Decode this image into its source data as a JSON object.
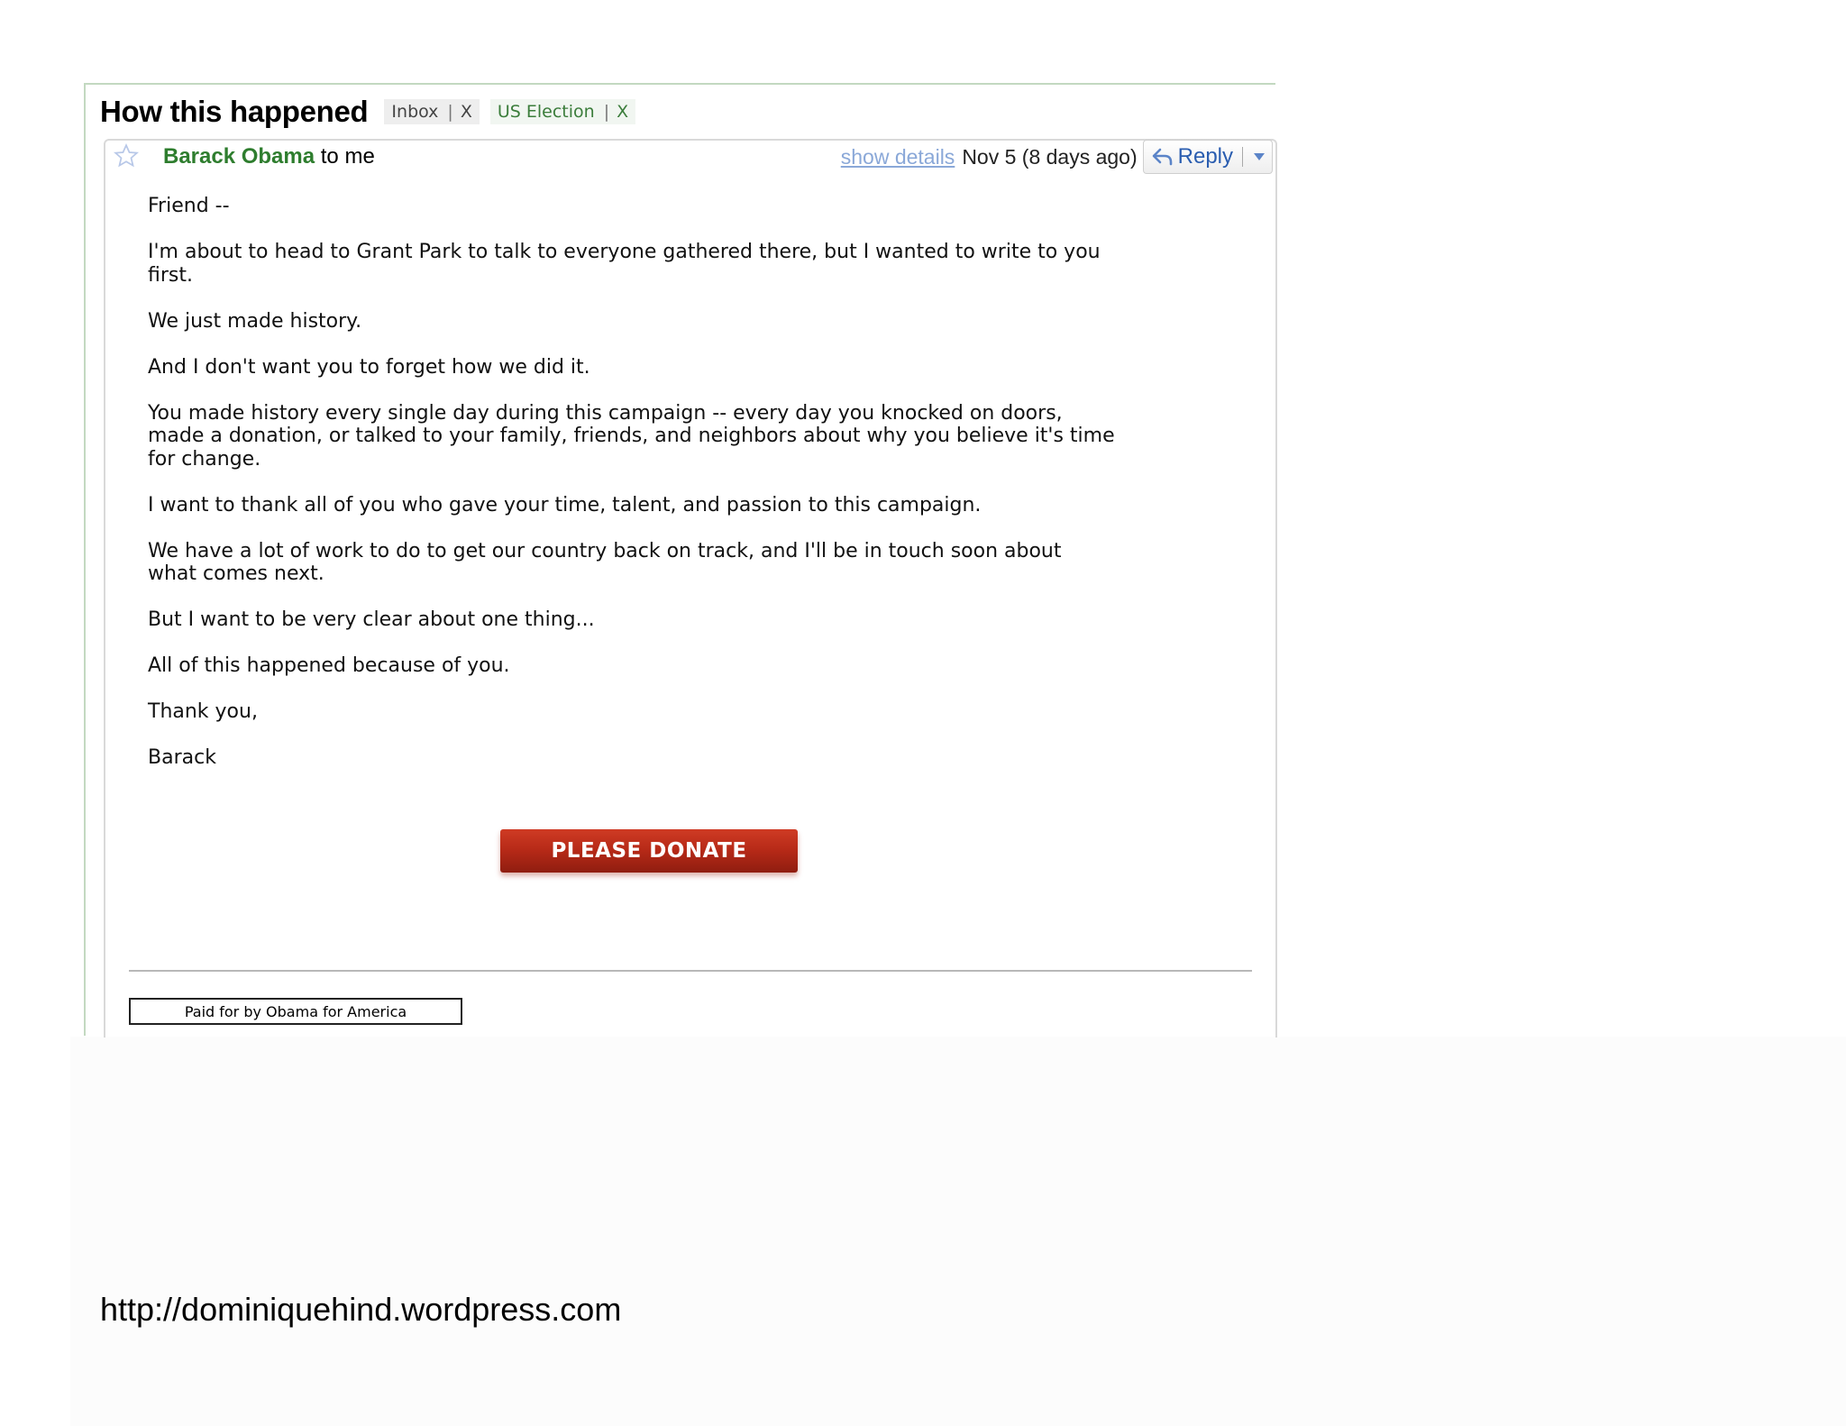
{
  "email": {
    "subject": "How this happened",
    "labels": [
      {
        "name": "Inbox",
        "remove": "X"
      },
      {
        "name": "US Election",
        "remove": "X"
      }
    ],
    "sender_name": "Barack Obama",
    "recipient": "to me",
    "show_details": "show details",
    "date": "Nov 5 (8 days ago)",
    "reply_label": "Reply",
    "body": [
      "Friend --",
      "I'm about to head to Grant Park to talk to everyone gathered there, but I wanted to write to you\nfirst.",
      "We just made history.",
      "And I don't want you to forget how we did it.",
      "You made history every single day during this campaign -- every day you knocked on doors,\nmade a donation, or talked to your family, friends, and neighbors about why you believe it's time\nfor change.",
      "I want to thank all of you who gave your time, talent, and passion to this campaign.",
      "We have a lot of work to do to get our country back on track, and I'll be in touch soon about\nwhat comes next.",
      "But I want to be very clear about one thing...",
      "All of this happened because of you.",
      "Thank you,",
      "Barack"
    ],
    "donate_button": "PLEASE DONATE",
    "paid_for": "Paid for by Obama for America"
  },
  "source_url": "http://dominiquehind.wordpress.com",
  "colors": {
    "sender_green": "#2e7d2e",
    "link_blue": "#2a5db0",
    "donate_red": "#b52917"
  },
  "icons": [
    "star-icon",
    "reply-arrow-icon",
    "chevron-down-icon"
  ]
}
